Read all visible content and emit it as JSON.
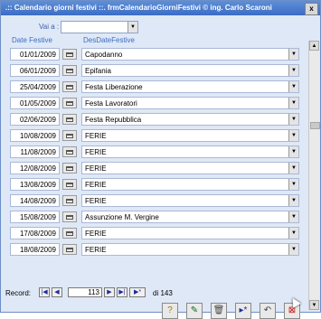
{
  "window": {
    "title": ".:: Calendario giorni festivi ::.    frmCalendarioGiorniFestivi © ing. Carlo Scaroni",
    "close_label": "x"
  },
  "filter": {
    "vai_label": "Vai a :",
    "value": ""
  },
  "columns": {
    "date": "Date Festive",
    "desc": "DesDateFestive"
  },
  "rows": [
    {
      "date": "01/01/2009",
      "desc": "Capodanno"
    },
    {
      "date": "06/01/2009",
      "desc": "Epifania"
    },
    {
      "date": "25/04/2009",
      "desc": "Festa Liberazione"
    },
    {
      "date": "01/05/2009",
      "desc": "Festa Lavoratori"
    },
    {
      "date": "02/06/2009",
      "desc": "Festa Repubblica"
    },
    {
      "date": "10/08/2009",
      "desc": "FERIE"
    },
    {
      "date": "11/08/2009",
      "desc": "FERIE"
    },
    {
      "date": "12/08/2009",
      "desc": "FERIE"
    },
    {
      "date": "13/08/2009",
      "desc": "FERIE"
    },
    {
      "date": "14/08/2009",
      "desc": "FERIE"
    },
    {
      "date": "15/08/2009",
      "desc": "Assunzione M. Vergine"
    },
    {
      "date": "17/08/2009",
      "desc": "FERIE"
    },
    {
      "date": "18/08/2009",
      "desc": "FERIE"
    }
  ],
  "navigation": {
    "label": "Record:",
    "current": "113",
    "of_text": "di 143",
    "first": "|◀",
    "prev": "◀",
    "next": "▶",
    "last": "▶|",
    "new": "▶*"
  },
  "toolbar": {
    "help": "?",
    "edit": "✎",
    "delete": "🗑",
    "new": "▸*",
    "undo": "↶",
    "exit": "⊠"
  },
  "colors": {
    "title_bar": "#3b6cc4",
    "background": "#dfe8f6",
    "header_text": "#3c6cc4"
  }
}
